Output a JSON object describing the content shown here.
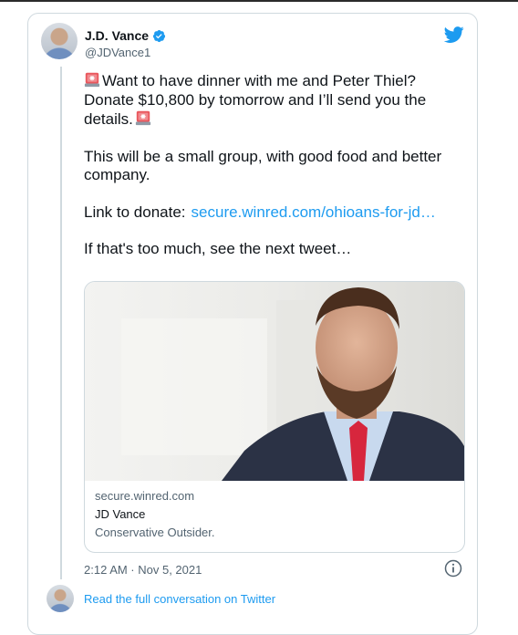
{
  "author": {
    "name": "J.D. Vance",
    "handle": "@JDVance1"
  },
  "tweet": {
    "line1": "Want to have dinner with me and Peter Thiel? Donate $10,800 by tomorrow and I’ll send you the details.",
    "line2": "This will be a small group, with good food and better company.",
    "line3_label": "Link to donate:",
    "line3_link": "secure.winred.com/ohioans-for-jd…",
    "line4": "If that's too much, see the next tweet…"
  },
  "link_card": {
    "domain": "secure.winred.com",
    "title": "JD Vance",
    "description": "Conservative Outsider."
  },
  "timestamp": "2:12 AM · Nov 5, 2021",
  "footer": {
    "read_full": "Read the full conversation on Twitter"
  },
  "icons": {
    "brand": "twitter-bird-icon",
    "verified": "verified-badge-icon",
    "siren": "police-light-icon",
    "info": "info-icon"
  },
  "colors": {
    "accent": "#1d9bf0",
    "text": "#0f1419",
    "secondary": "#536471",
    "border": "#cfd9de"
  }
}
